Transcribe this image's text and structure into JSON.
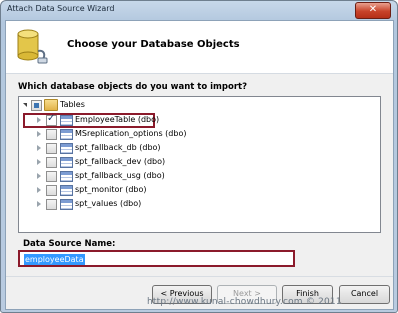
{
  "window": {
    "title": "Attach Data Source Wizard",
    "close_glyph": "✕"
  },
  "header": {
    "title": "Choose your Database Objects",
    "icon": "database-icon"
  },
  "question": "Which database objects do you want to import?",
  "tree": {
    "root": {
      "label": "Tables",
      "expanded": true,
      "checked": "partial"
    },
    "items": [
      {
        "label": "EmployeeTable (dbo)",
        "checked": true,
        "highlighted": true
      },
      {
        "label": "MSreplication_options (dbo)",
        "checked": false
      },
      {
        "label": "spt_fallback_db (dbo)",
        "checked": false
      },
      {
        "label": "spt_fallback_dev (dbo)",
        "checked": false
      },
      {
        "label": "spt_fallback_usg (dbo)",
        "checked": false
      },
      {
        "label": "spt_monitor (dbo)",
        "checked": false
      },
      {
        "label": "spt_values (dbo)",
        "checked": false
      }
    ]
  },
  "data_source": {
    "label": "Data Source Name:",
    "value": "employeeData"
  },
  "buttons": {
    "previous": "< Previous",
    "next": "Next >",
    "finish": "Finish",
    "cancel": "Cancel"
  },
  "watermark": "http://www.kunal-chowdhury.com © 2011",
  "colors": {
    "highlight_border": "#8b1a2b",
    "selection": "#3399ff"
  }
}
